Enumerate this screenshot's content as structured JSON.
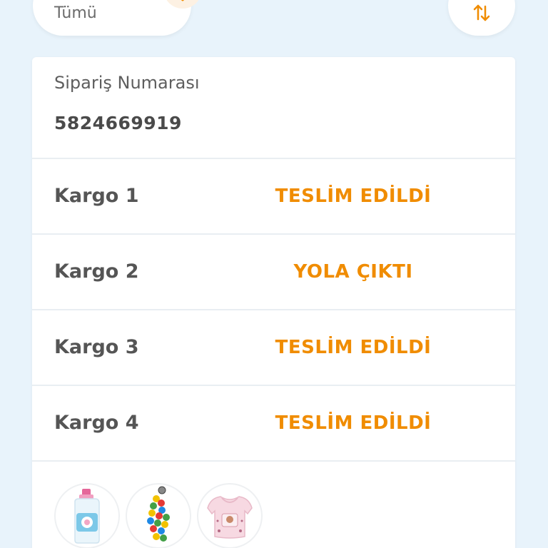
{
  "filter": {
    "label": "Tümü",
    "icon": "chevron-down-icon"
  },
  "sort": {
    "icon": "sort-arrows-icon"
  },
  "order": {
    "label": "Sipariş Numarası",
    "number": "5824669919"
  },
  "shipments": [
    {
      "name": "Kargo 1",
      "status": "TESLİM EDİLDİ"
    },
    {
      "name": "Kargo 2",
      "status": "YOLA ÇIKTI"
    },
    {
      "name": "Kargo 3",
      "status": "TESLİM EDİLDİ"
    },
    {
      "name": "Kargo 4",
      "status": "TESLİM EDİLDİ"
    }
  ],
  "products": [
    "detergent-bottle-image",
    "colorful-ball-toy-image",
    "baby-bib-image"
  ],
  "colors": {
    "accent": "#f08c00",
    "background": "#e8f3fb"
  }
}
